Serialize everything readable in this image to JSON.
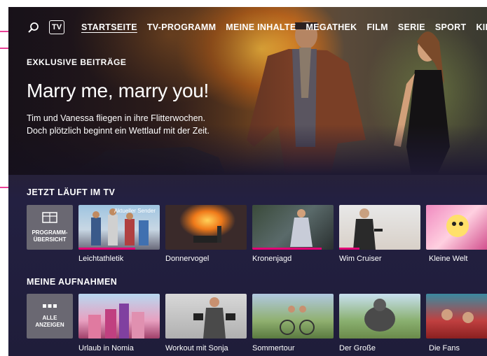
{
  "colors": {
    "accent": "#e20074",
    "annotation": "#e20074"
  },
  "nav": {
    "search_icon": "search-icon",
    "tv_label": "TV",
    "items": [
      {
        "label": "STARTSEITE",
        "active": true
      },
      {
        "label": "TV-PROGRAMM",
        "active": false
      },
      {
        "label": "MEINE INHALTE",
        "active": false
      },
      {
        "label": "MEGATHEK",
        "active": false
      },
      {
        "label": "FILM",
        "active": false
      },
      {
        "label": "SERIE",
        "active": false
      },
      {
        "label": "SPORT",
        "active": false
      },
      {
        "label": "KIDS",
        "active": false
      }
    ]
  },
  "hero": {
    "kicker": "EXKLUSIVE BEITRÄGE",
    "title": "Marry me, marry you!",
    "description_line1": "Tim und Vanessa fliegen in ihre Flitterwochen.",
    "description_line2": "Doch plötzlich beginnt ein Wettlauf mit der Zeit."
  },
  "live_tv": {
    "section_title": "JETZT LÄUFT IM TV",
    "action": {
      "label_line1": "PROGRAMM-",
      "label_line2": "ÜBERSICHT",
      "icon": "grid-icon"
    },
    "items": [
      {
        "label": "Leichtathletik",
        "badge": "Aktueller Sender",
        "progress": 0.7
      },
      {
        "label": "Donnervogel",
        "badge": "",
        "progress": 0
      },
      {
        "label": "Kronenjagd",
        "badge": "",
        "progress": 0.85
      },
      {
        "label": "Wim Cruiser",
        "badge": "",
        "progress": 0.25
      },
      {
        "label": "Kleine Welt",
        "badge": "",
        "progress": 0
      }
    ]
  },
  "recordings": {
    "section_title": "MEINE AUFNAHMEN",
    "action": {
      "label_line1": "ALLE",
      "label_line2": "ANZEIGEN",
      "icon": "dots-icon"
    },
    "items": [
      {
        "label": "Urlaub in Nomia"
      },
      {
        "label": "Workout mit Sonja"
      },
      {
        "label": "Sommertour"
      },
      {
        "label": "Der Große"
      },
      {
        "label": "Die Fans"
      }
    ]
  }
}
